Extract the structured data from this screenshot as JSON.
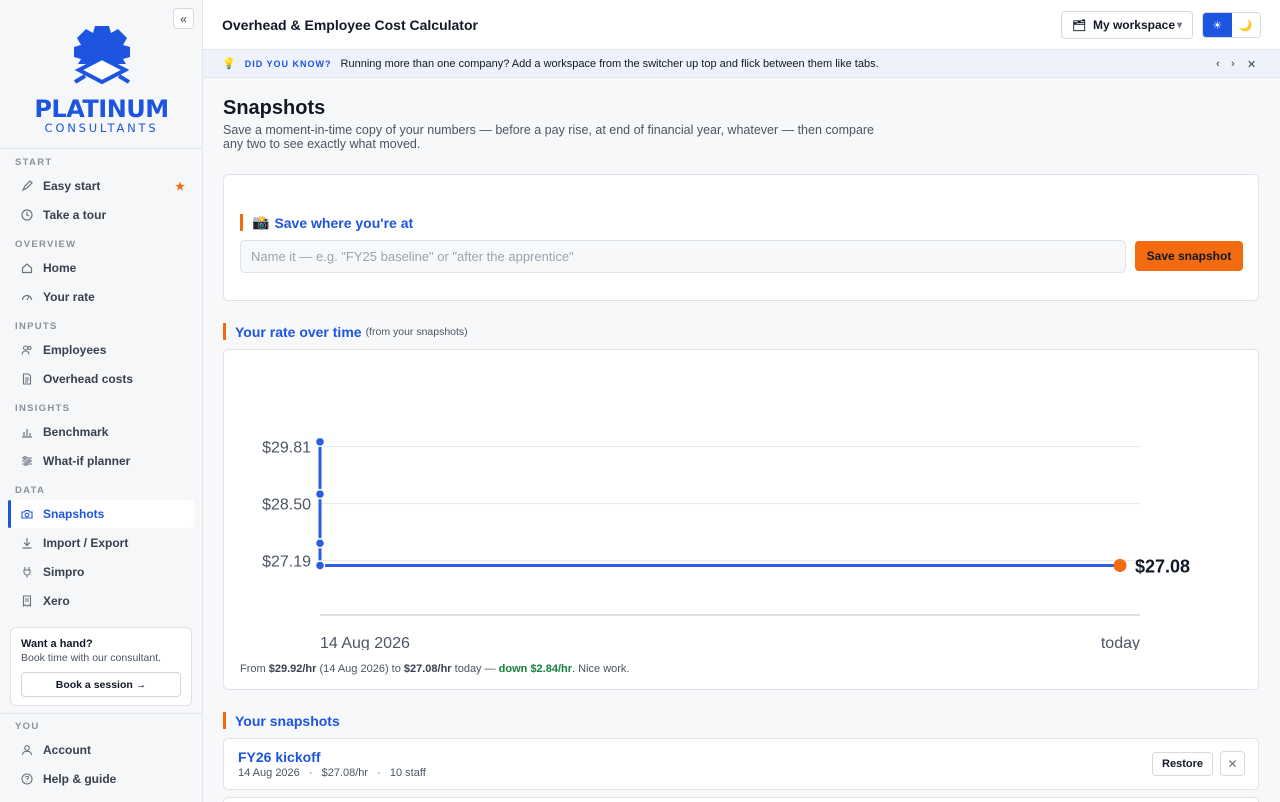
{
  "sidebar": {
    "collapse_label": "«",
    "logo": {
      "name": "PLATINUM",
      "sub": "CONSULTANTS"
    },
    "sections": {
      "start": "START",
      "overview": "OVERVIEW",
      "inputs": "INPUTS",
      "insights": "INSIGHTS",
      "data": "DATA",
      "you": "YOU"
    },
    "items": {
      "easy_start": "Easy start",
      "take_tour": "Take a tour",
      "home": "Home",
      "your_rate": "Your rate",
      "employees": "Employees",
      "overhead_costs": "Overhead costs",
      "benchmark": "Benchmark",
      "what_if": "What-if planner",
      "snapshots": "Snapshots",
      "import_export": "Import / Export",
      "simpro": "Simpro",
      "xero": "Xero",
      "account": "Account",
      "help_guide": "Help & guide"
    },
    "star": "★",
    "help_card": {
      "title": "Want a hand?",
      "subtitle": "Book time with our consultant.",
      "button": "Book a session →"
    }
  },
  "topbar": {
    "title": "Overhead & Employee Cost Calculator",
    "workspace_icon": "🗂",
    "workspace": "My workspace",
    "workspace_chevron": "▾",
    "theme_light": "☀",
    "theme_dark": "🌙"
  },
  "tip": {
    "bulb": "💡",
    "label": "DID YOU KNOW?",
    "text": "Running more than one company? Add a workspace from the switcher up top and flick between them like tabs.",
    "prev": "‹",
    "next": "›",
    "close": "✕"
  },
  "page": {
    "title": "Snapshots",
    "subtitle": "Save a moment-in-time copy of your numbers — before a pay rise, at end of financial year, whatever — then compare any two to see exactly what moved."
  },
  "save_section": {
    "emoji": "📸",
    "heading": "Save where you're at",
    "placeholder": "Name it — e.g. \"FY25 baseline\" or \"after the apprentice\"",
    "button": "Save snapshot"
  },
  "rate_section": {
    "heading": "Your rate over time",
    "heading_note": "(from your snapshots)",
    "summary": {
      "from_label": "From ",
      "from_value": "$29.92/hr",
      "from_date": " (14 Aug 2026) to ",
      "to_value": "$27.08/hr",
      "to_label": " today — ",
      "change": "down $2.84/hr",
      "tail": ". Nice work."
    }
  },
  "chart_data": {
    "type": "line",
    "y_ticks": [
      "$29.81",
      "$28.50",
      "$27.19"
    ],
    "y_tick_values": [
      29.81,
      28.5,
      27.19
    ],
    "x_labels": [
      "14 Aug 2026",
      "today"
    ],
    "points": [
      {
        "x": "14 Aug 2026",
        "y": 29.92
      },
      {
        "x": "14 Aug 2026",
        "y": 28.72
      },
      {
        "x": "14 Aug 2026",
        "y": 27.59
      },
      {
        "x": "14 Aug 2026",
        "y": 27.08
      }
    ],
    "final_point": {
      "x": "today",
      "y": 27.08
    },
    "final_label": "$27.08",
    "ylim": [
      26.7,
      30.1
    ],
    "line_color": "#2b5ce6",
    "final_color": "#f26b0f",
    "grid": true
  },
  "snapshots_section": {
    "heading": "Your snapshots",
    "items": [
      {
        "name": "FY26 kickoff",
        "date": "14 Aug 2026",
        "rate": "$27.08/hr",
        "staff": "10 staff",
        "sep": "·",
        "restore": "Restore",
        "delete": "✕"
      }
    ]
  },
  "colors": {
    "brand_blue": "#1d55e0",
    "accent_orange": "#f26b0f",
    "positive_green": "#15803d"
  }
}
